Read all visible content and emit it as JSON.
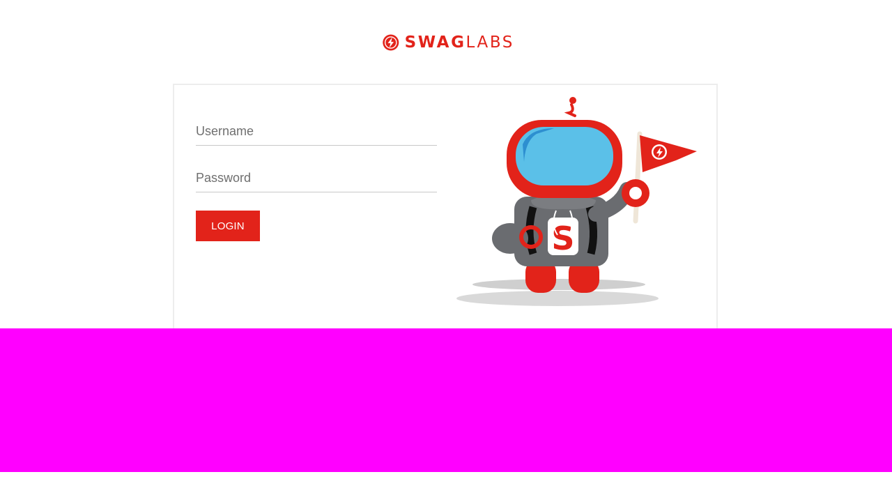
{
  "logo": {
    "text_bold": "SWAG",
    "text_light": "LABS",
    "brand_color": "#e2231a",
    "icon": "lightning-bolt-circle-icon"
  },
  "login_form": {
    "username_placeholder": "Username",
    "username_value": "",
    "password_placeholder": "Password",
    "password_value": "",
    "login_label": "LOGIN"
  },
  "mascot": {
    "icon": "robot-mascot-with-flag-illustration"
  },
  "colors": {
    "accent": "#e2231a",
    "overlay_bar": "#ff00ff",
    "card_border": "#ededed"
  }
}
